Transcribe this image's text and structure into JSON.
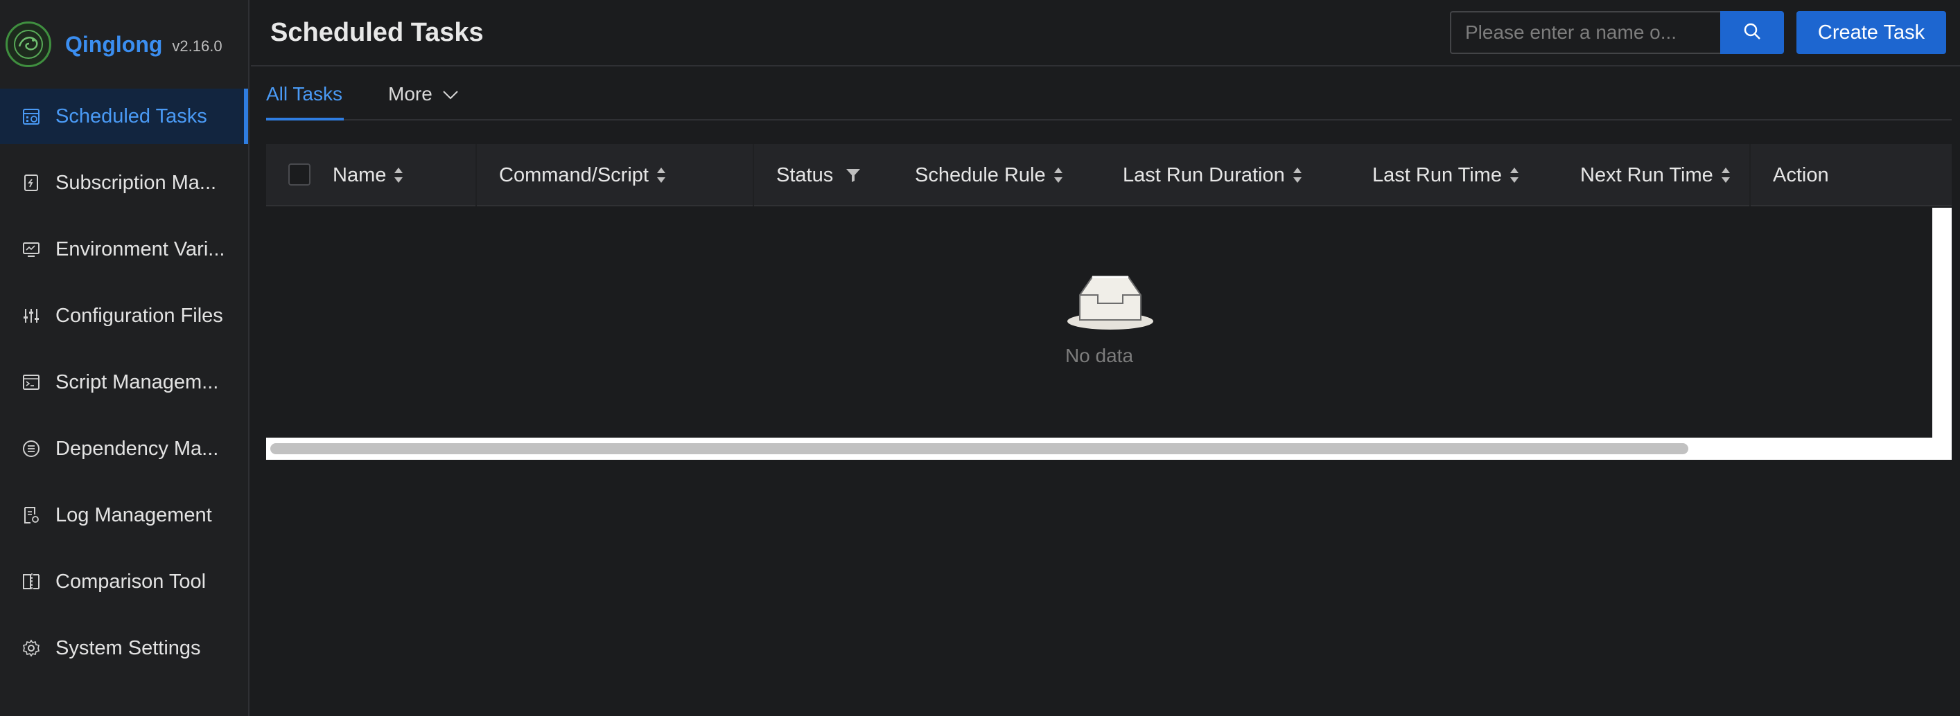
{
  "app": {
    "name": "Qinglong",
    "version": "v2.16.0"
  },
  "sidebar": {
    "items": [
      {
        "label": "Scheduled Tasks",
        "icon": "calendar-clock-icon",
        "active": true
      },
      {
        "label": "Subscription Ma...",
        "icon": "subscription-icon",
        "active": false
      },
      {
        "label": "Environment Vari...",
        "icon": "monitor-icon",
        "active": false
      },
      {
        "label": "Configuration Files",
        "icon": "sliders-icon",
        "active": false
      },
      {
        "label": "Script Managem...",
        "icon": "terminal-window-icon",
        "active": false
      },
      {
        "label": "Dependency Ma...",
        "icon": "list-circle-icon",
        "active": false
      },
      {
        "label": "Log Management",
        "icon": "log-file-icon",
        "active": false
      },
      {
        "label": "Comparison Tool",
        "icon": "diff-icon",
        "active": false
      },
      {
        "label": "System Settings",
        "icon": "gear-icon",
        "active": false
      }
    ]
  },
  "header": {
    "title": "Scheduled Tasks",
    "search_placeholder": "Please enter a name o...",
    "create_label": "Create Task"
  },
  "tabs": [
    {
      "label": "All Tasks",
      "active": true
    },
    {
      "label": "More",
      "active": false
    }
  ],
  "table": {
    "columns": [
      {
        "label": "Name",
        "icon": "sort-icon"
      },
      {
        "label": "Command/Script",
        "icon": "sort-icon"
      },
      {
        "label": "Status",
        "icon": "filter-icon"
      },
      {
        "label": "Schedule Rule",
        "icon": "sort-icon"
      },
      {
        "label": "Last Run Duration",
        "icon": "sort-icon"
      },
      {
        "label": "Last Run Time",
        "icon": "sort-icon"
      },
      {
        "label": "Next Run Time",
        "icon": "sort-icon"
      },
      {
        "label": "Action",
        "icon": ""
      }
    ],
    "rows": [],
    "empty_text": "No data"
  },
  "colors": {
    "accent": "#1d66d0",
    "active_text": "#4a9af5",
    "background": "#1b1c1e",
    "sidebar_bg": "#1f2022"
  }
}
